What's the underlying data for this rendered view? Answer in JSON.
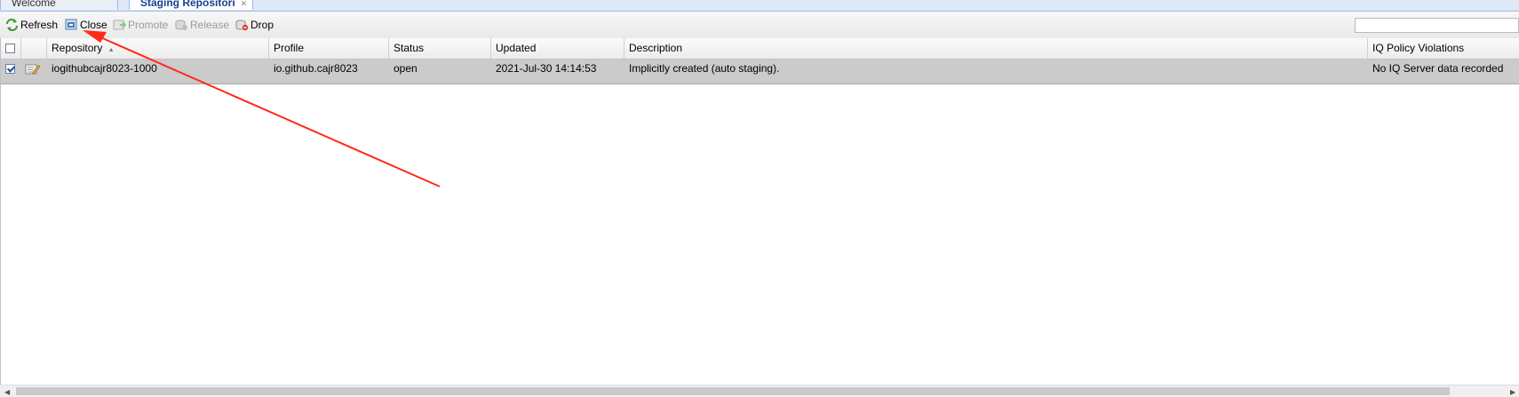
{
  "tabs": [
    {
      "label": "Welcome",
      "active": false
    },
    {
      "label": "Staging Repositori",
      "active": true
    }
  ],
  "toolbar": {
    "refresh": "Refresh",
    "close": "Close",
    "promote": "Promote",
    "release": "Release",
    "drop": "Drop",
    "search_value": ""
  },
  "grid": {
    "columns": [
      "Repository",
      "Profile",
      "Status",
      "Updated",
      "Description",
      "IQ Policy Violations"
    ],
    "sort_indicator": "▲",
    "rows": [
      {
        "selected": true,
        "repository": "iogithubcajr8023-1000",
        "profile": "io.github.cajr8023",
        "status": "open",
        "updated": "2021-Jul-30 14:14:53",
        "description": "Implicitly created (auto staging).",
        "iq": "No IQ Server data recorded"
      }
    ]
  },
  "colors": {
    "annotation_arrow": "#ff2a1a",
    "selected_row": "#cbcbcb",
    "tab_text": "#15428b"
  }
}
